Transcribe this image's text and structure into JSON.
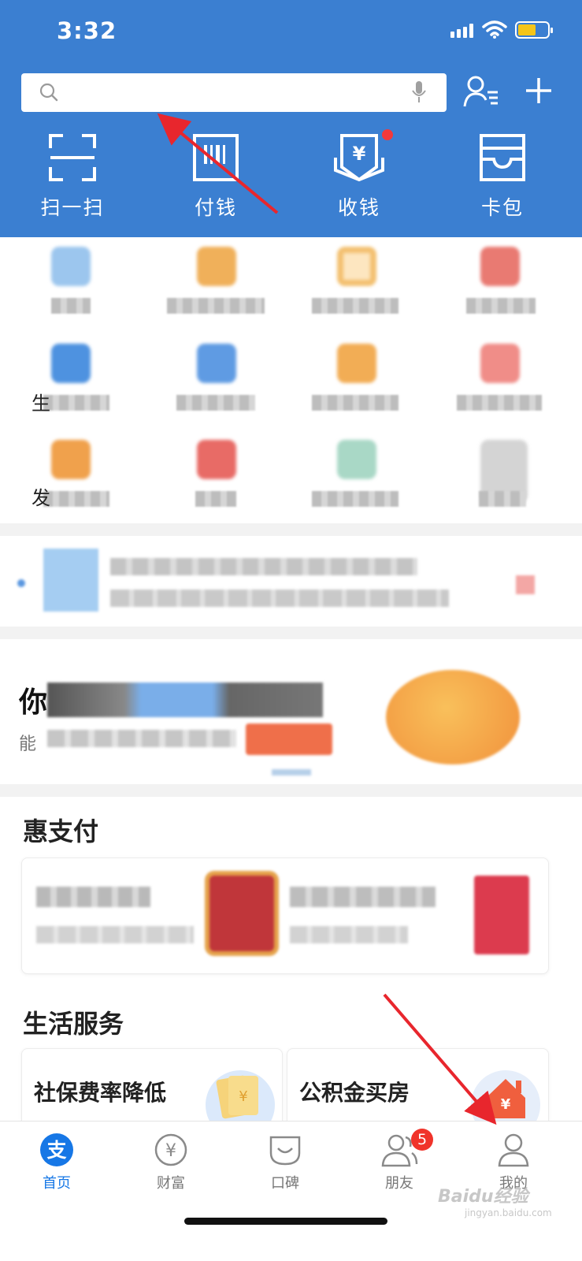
{
  "status_bar": {
    "time": "3:32"
  },
  "search": {
    "placeholder": ""
  },
  "header_icons": {
    "contacts": "contacts-icon",
    "add": "plus-icon"
  },
  "quick_actions": [
    {
      "label": "扫一扫",
      "icon": "scan-icon"
    },
    {
      "label": "付钱",
      "icon": "barcode-pay-icon"
    },
    {
      "label": "收钱",
      "icon": "receive-money-icon"
    },
    {
      "label": "卡包",
      "icon": "card-wallet-icon"
    }
  ],
  "grid_partial_chars": [
    "生",
    "发"
  ],
  "promo_banner": {
    "title_char": "你",
    "subtitle_char": "能"
  },
  "sections": {
    "hui_pay": {
      "title": "惠支付"
    },
    "life_services": {
      "title": "生活服务",
      "cards": [
        {
          "title": "社保费率降低"
        },
        {
          "title": "公积金买房"
        }
      ]
    }
  },
  "tabbar": {
    "items": [
      {
        "label": "首页",
        "icon": "alipay-home-icon",
        "active": true
      },
      {
        "label": "财富",
        "icon": "wealth-yen-icon",
        "active": false
      },
      {
        "label": "口碑",
        "icon": "koubei-icon",
        "active": false
      },
      {
        "label": "朋友",
        "icon": "friends-icon",
        "active": false,
        "badge": "5"
      },
      {
        "label": "我的",
        "icon": "profile-icon",
        "active": false
      }
    ]
  },
  "watermark": {
    "text": "Baidu经验",
    "sub": "jingyan.baidu.com"
  },
  "colors": {
    "header_blue": "#3b7fd1",
    "tab_active": "#1677e6",
    "badge_red": "#f0332a",
    "arrow_red": "#e8262d"
  }
}
